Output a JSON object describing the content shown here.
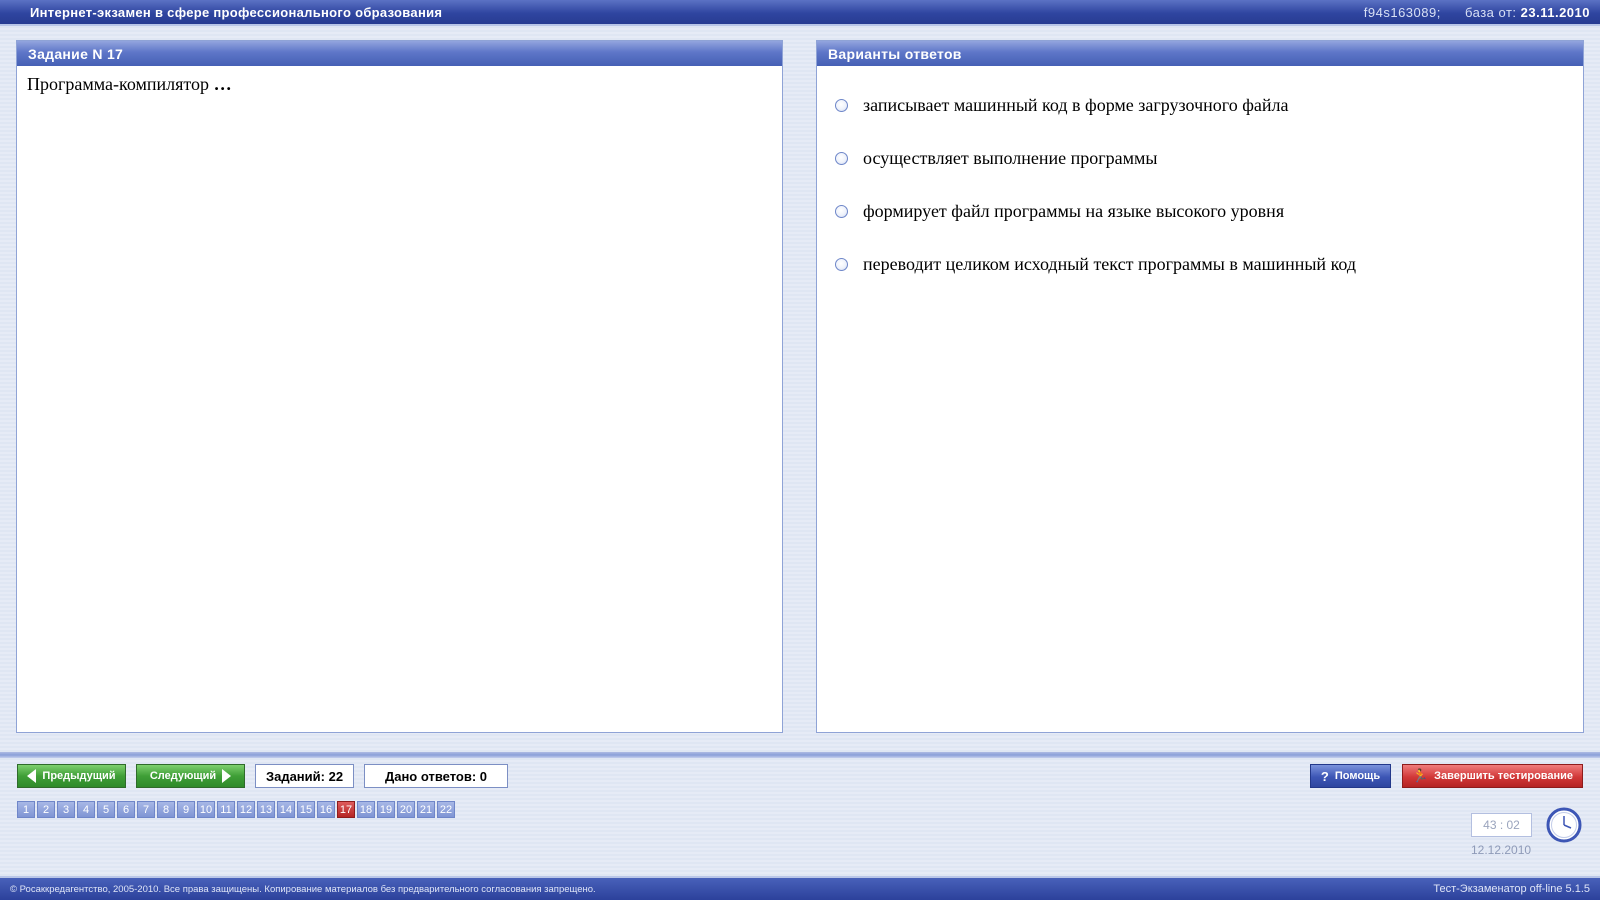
{
  "header": {
    "title": "Интернет-экзамен в сфере профессионального образования",
    "code": "f94s163089;",
    "base_label": "база от:",
    "base_date": "23.11.2010"
  },
  "task": {
    "heading": "Задание N 17",
    "question": "Программа-компилятор",
    "ellipsis": "…"
  },
  "answers": {
    "heading": "Варианты ответов",
    "options": [
      "записывает машинный код в форме загрузочного файла",
      "осуществляет выполнение программы",
      "формирует файл программы на языке высокого уровня",
      "переводит целиком исходный текст программы в машинный код"
    ]
  },
  "toolbar": {
    "prev_label": "Предыдущий",
    "next_label": "Следующий",
    "tasks_count": "Заданий: 22",
    "answers_given": "Дано ответов: 0",
    "help_label": "Помощь",
    "finish_label": "Завершить тестирование"
  },
  "task_nav": {
    "items": [
      "1",
      "2",
      "3",
      "4",
      "5",
      "6",
      "7",
      "8",
      "9",
      "10",
      "11",
      "12",
      "13",
      "14",
      "15",
      "16",
      "17",
      "18",
      "19",
      "20",
      "21",
      "22"
    ],
    "current": "17"
  },
  "timer": {
    "value": "43 : 02",
    "date": "12.12.2010"
  },
  "footer": {
    "copyright": "© Росаккредагентство, 2005-2010. Все права защищены. Копирование материалов без предварительного согласования запрещено.",
    "version": "Тест-Экзаменатор off-line 5.1.5"
  },
  "colors": {
    "header_blue": "#2f45a0",
    "button_green": "#3f9f37",
    "button_blue": "#3d56b5",
    "button_red": "#d13838",
    "current_task": "#b52525"
  }
}
